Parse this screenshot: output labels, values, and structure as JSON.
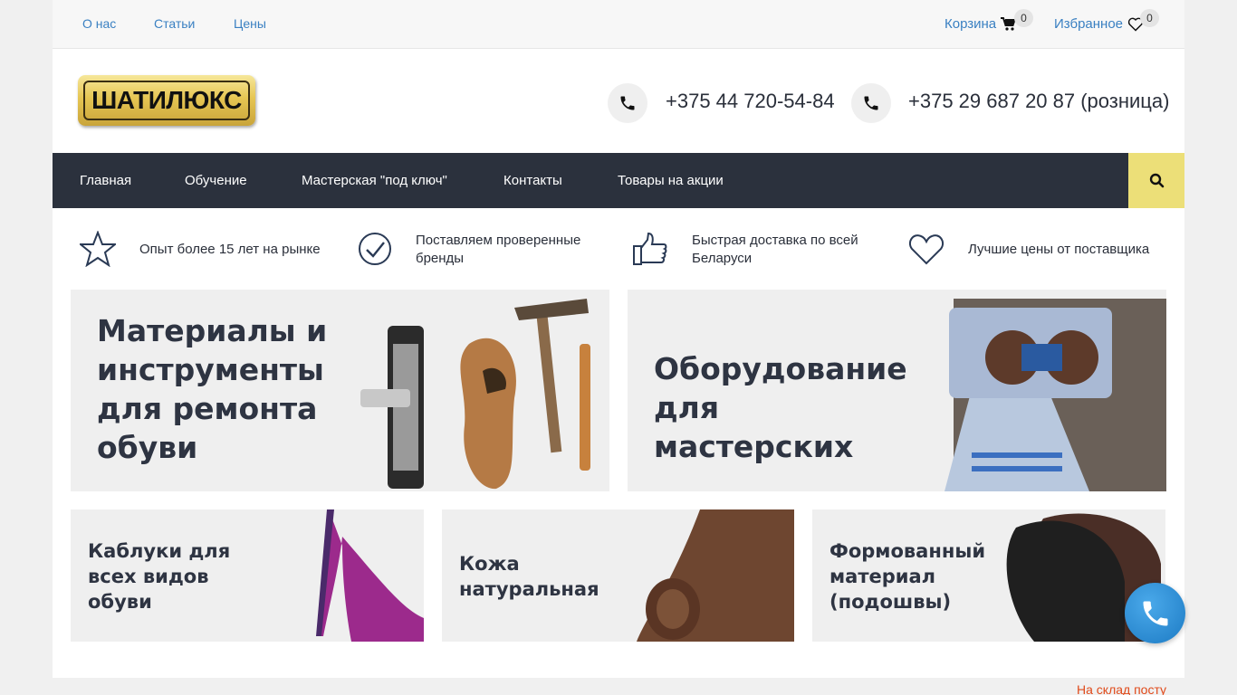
{
  "topbar": {
    "links": [
      "О нас",
      "Статьи",
      "Цены"
    ],
    "cart_label": "Корзина",
    "cart_count": "0",
    "fav_label": "Избранное",
    "fav_count": "0"
  },
  "header": {
    "logo_text": "ШАТИЛЮКС",
    "phone1": "+375 44 720-54-84",
    "phone2": "+375 29 687 20 87 (розница)"
  },
  "nav": {
    "items": [
      "Главная",
      "Обучение",
      "Мастерская \"под ключ\"",
      "Контакты",
      "Товары на акции"
    ]
  },
  "features": [
    "Опыт более 15 лет на рынке",
    "Поставляем проверенные бренды",
    "Быстрая доставка по всей Беларуси",
    "Лучшие цены от поставщика"
  ],
  "banners": {
    "materials": "Материалы и инструменты для ремонта обуви",
    "equipment": "Оборудование для мастерских",
    "heels": "Каблуки для всех видов обуви",
    "leather": "Кожа натуральная",
    "soles": "Формованный материал (подошвы)"
  },
  "footer_note": "На склад посту",
  "colors": {
    "nav_bg": "#2b313d",
    "search_bg": "#ecdf78",
    "link": "#3a80c2",
    "accent_text": "#e04a1a"
  }
}
